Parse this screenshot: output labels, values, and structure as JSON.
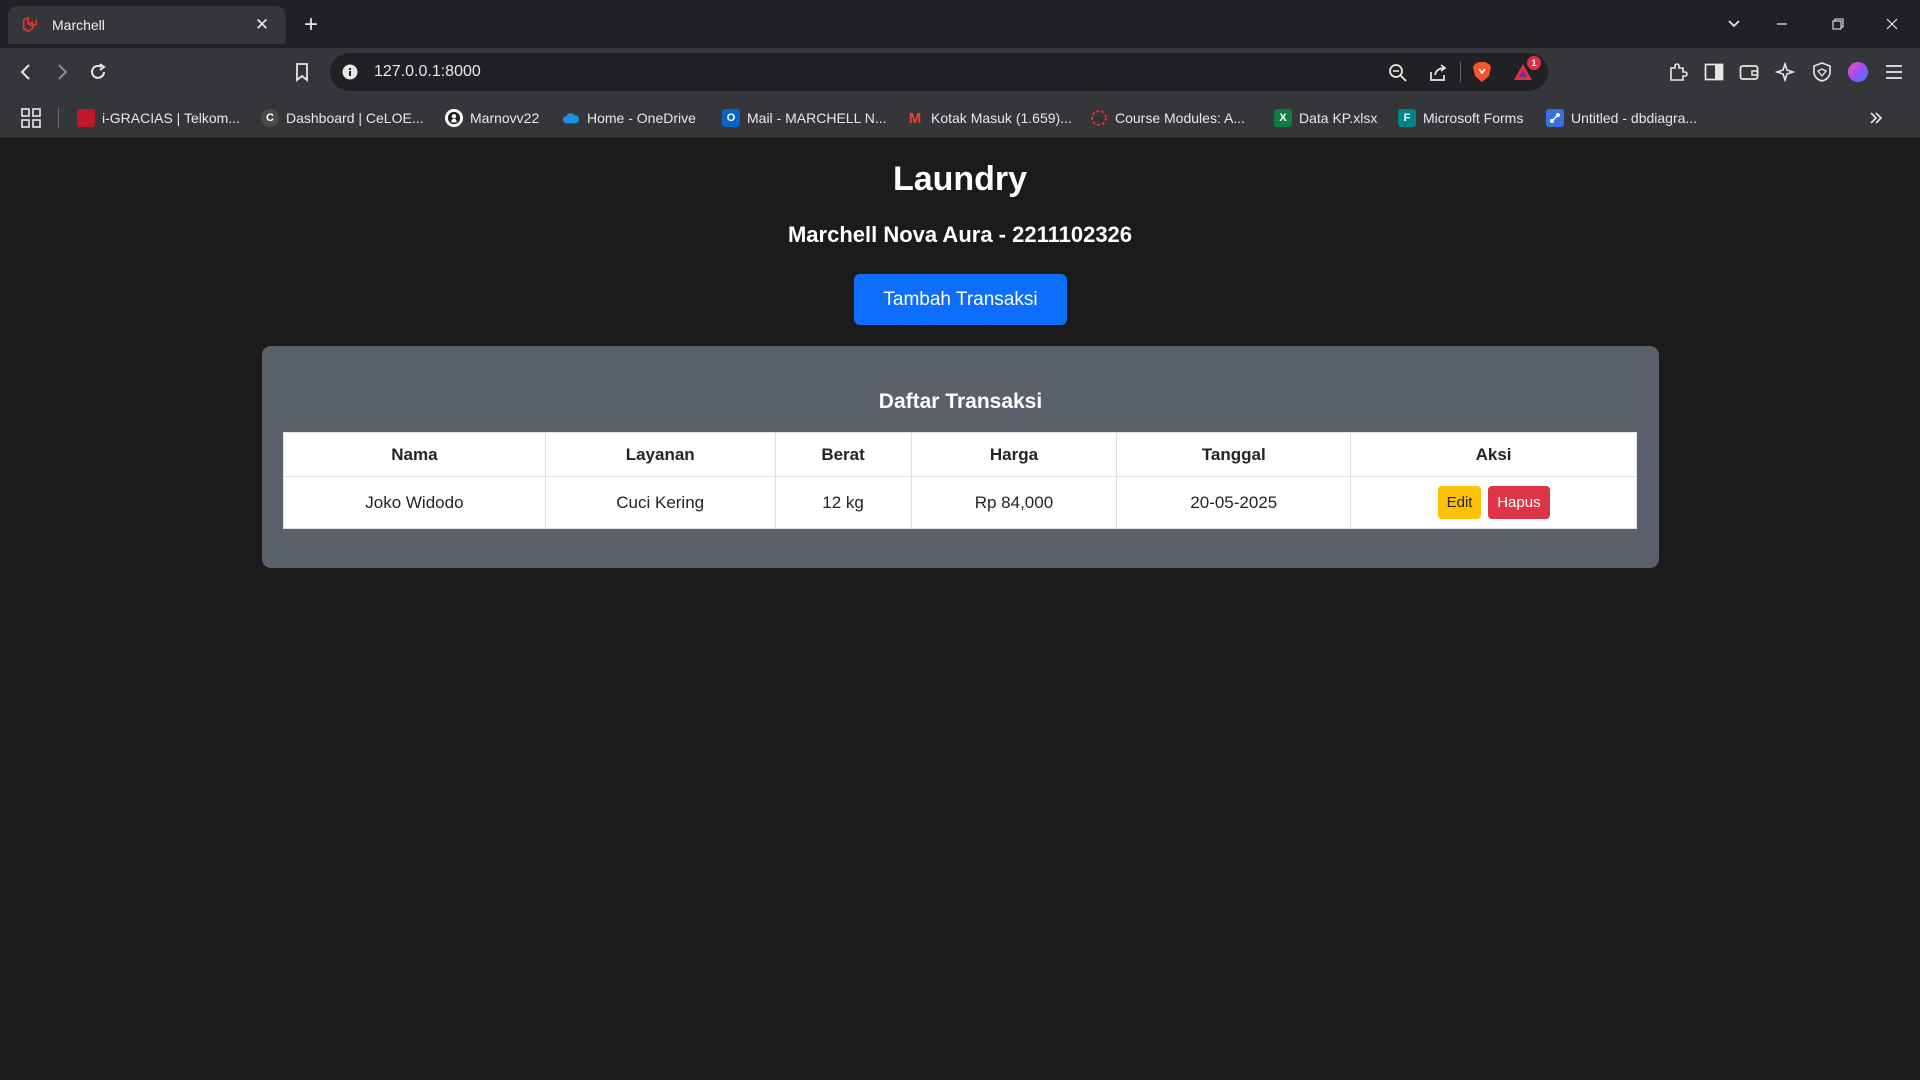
{
  "browser": {
    "tab": {
      "title": "Marchell"
    },
    "url": "127.0.0.1:8000",
    "notification_count": "1",
    "bookmarks": [
      {
        "label": "i-GRACIAS | Telkom...",
        "color": "#c0182b",
        "glyph": ""
      },
      {
        "label": "Dashboard | CeLOE...",
        "color": "#4a4a4a",
        "glyph": "C"
      },
      {
        "label": "Marnovv22",
        "color": "#202124",
        "glyph": ""
      },
      {
        "label": "Home - OneDrive",
        "color": "#0f78d4",
        "glyph": ""
      },
      {
        "label": "Mail - MARCHELL N...",
        "color": "#0a64c8",
        "glyph": "O"
      },
      {
        "label": "Kotak Masuk (1.659)...",
        "color": "#ea4335",
        "glyph": "M"
      },
      {
        "label": "Course Modules: A...",
        "color": "#e0302e",
        "glyph": ""
      },
      {
        "label": "Data KP.xlsx",
        "color": "#107c41",
        "glyph": "X"
      },
      {
        "label": "Microsoft Forms",
        "color": "#038387",
        "glyph": "F"
      },
      {
        "label": "Untitled - dbdiagra...",
        "color": "#3a6fe0",
        "glyph": ""
      }
    ]
  },
  "page": {
    "title": "Laundry",
    "subtitle": "Marchell Nova Aura - 2211102326",
    "add_button": "Tambah Transaksi",
    "card_title": "Daftar Transaksi",
    "table": {
      "headers": [
        "Nama",
        "Layanan",
        "Berat",
        "Harga",
        "Tanggal",
        "Aksi"
      ],
      "rows": [
        {
          "nama": "Joko Widodo",
          "layanan": "Cuci Kering",
          "berat": "12 kg",
          "harga": "Rp 84,000",
          "tanggal": "20-05-2025",
          "edit_label": "Edit",
          "delete_label": "Hapus"
        }
      ]
    }
  },
  "colors": {
    "primary": "#0d6efd",
    "warning": "#ffc107",
    "danger": "#dc3545",
    "card": "#5b616b",
    "background": "#1b1b1b"
  }
}
